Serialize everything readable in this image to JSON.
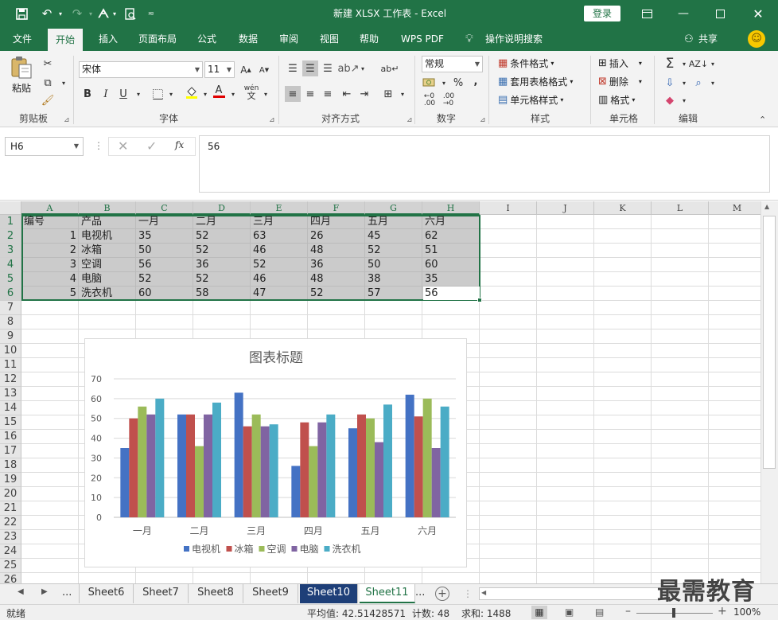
{
  "titlebar": {
    "title": "新建 XLSX 工作表 - Excel",
    "login": "登录"
  },
  "menu": {
    "tabs": [
      "文件",
      "开始",
      "插入",
      "页面布局",
      "公式",
      "数据",
      "审阅",
      "视图",
      "帮助",
      "WPS PDF"
    ],
    "tellme": "操作说明搜索",
    "share": "共享"
  },
  "ribbon": {
    "clipboard": {
      "paste": "粘贴",
      "label": "剪贴板"
    },
    "font": {
      "name": "宋体",
      "size": "11",
      "label": "字体",
      "bold": "B",
      "italic": "I",
      "underline": "U",
      "phonetic": "wén"
    },
    "align": {
      "label": "对齐方式"
    },
    "number": {
      "format": "常规",
      "label": "数字",
      "percent": "%",
      "comma": ","
    },
    "styles": {
      "cond": "条件格式",
      "table": "套用表格格式",
      "cell": "单元格样式",
      "label": "样式"
    },
    "cells": {
      "insert": "插入",
      "delete": "删除",
      "format": "格式",
      "label": "单元格"
    },
    "editing": {
      "label": "编辑"
    }
  },
  "formula": {
    "namebox": "H6",
    "fx": "fx",
    "value": "56"
  },
  "grid": {
    "columns": [
      "A",
      "B",
      "C",
      "D",
      "E",
      "F",
      "G",
      "H",
      "I",
      "J",
      "K",
      "L",
      "M"
    ],
    "rows": [
      "1",
      "2",
      "3",
      "4",
      "5",
      "6",
      "7",
      "8",
      "9",
      "10",
      "11",
      "12",
      "13",
      "14",
      "15",
      "16",
      "17",
      "18",
      "19",
      "20",
      "21",
      "22",
      "23",
      "24",
      "25",
      "26"
    ],
    "header": [
      "编号",
      "产品",
      "一月",
      "二月",
      "三月",
      "四月",
      "五月",
      "六月"
    ],
    "data": [
      [
        "1",
        "电视机",
        "35",
        "52",
        "63",
        "26",
        "45",
        "62"
      ],
      [
        "2",
        "冰箱",
        "50",
        "52",
        "46",
        "48",
        "52",
        "51"
      ],
      [
        "3",
        "空调",
        "56",
        "36",
        "52",
        "36",
        "50",
        "60"
      ],
      [
        "4",
        "电脑",
        "52",
        "52",
        "46",
        "48",
        "38",
        "35"
      ],
      [
        "5",
        "洗衣机",
        "60",
        "58",
        "47",
        "52",
        "57",
        "56"
      ]
    ]
  },
  "chart_data": {
    "type": "bar",
    "title": "图表标题",
    "categories": [
      "一月",
      "二月",
      "三月",
      "四月",
      "五月",
      "六月"
    ],
    "series": [
      {
        "name": "电视机",
        "values": [
          35,
          52,
          63,
          26,
          45,
          62
        ],
        "color": "#4472c4"
      },
      {
        "name": "冰箱",
        "values": [
          50,
          52,
          46,
          48,
          52,
          51
        ],
        "color": "#c0504d"
      },
      {
        "name": "空调",
        "values": [
          56,
          36,
          52,
          36,
          50,
          60
        ],
        "color": "#9bbb59"
      },
      {
        "name": "电脑",
        "values": [
          52,
          52,
          46,
          48,
          38,
          35
        ],
        "color": "#8064a2"
      },
      {
        "name": "洗衣机",
        "values": [
          60,
          58,
          47,
          52,
          57,
          56
        ],
        "color": "#4bacc6"
      }
    ],
    "ylim": [
      0,
      70
    ],
    "yticks": [
      "0",
      "10",
      "20",
      "30",
      "40",
      "50",
      "60",
      "70"
    ],
    "grid": true,
    "legend": "bottom"
  },
  "sheets": {
    "more": "...",
    "tabs": [
      "Sheet6",
      "Sheet7",
      "Sheet8",
      "Sheet9",
      "Sheet10",
      "Sheet11"
    ],
    "more_right": "..."
  },
  "status": {
    "ready": "就绪",
    "average": "平均值: 42.51428571",
    "count": "计数: 48",
    "sum": "求和: 1488",
    "zoom": "100%"
  },
  "watermark": "最需教育"
}
